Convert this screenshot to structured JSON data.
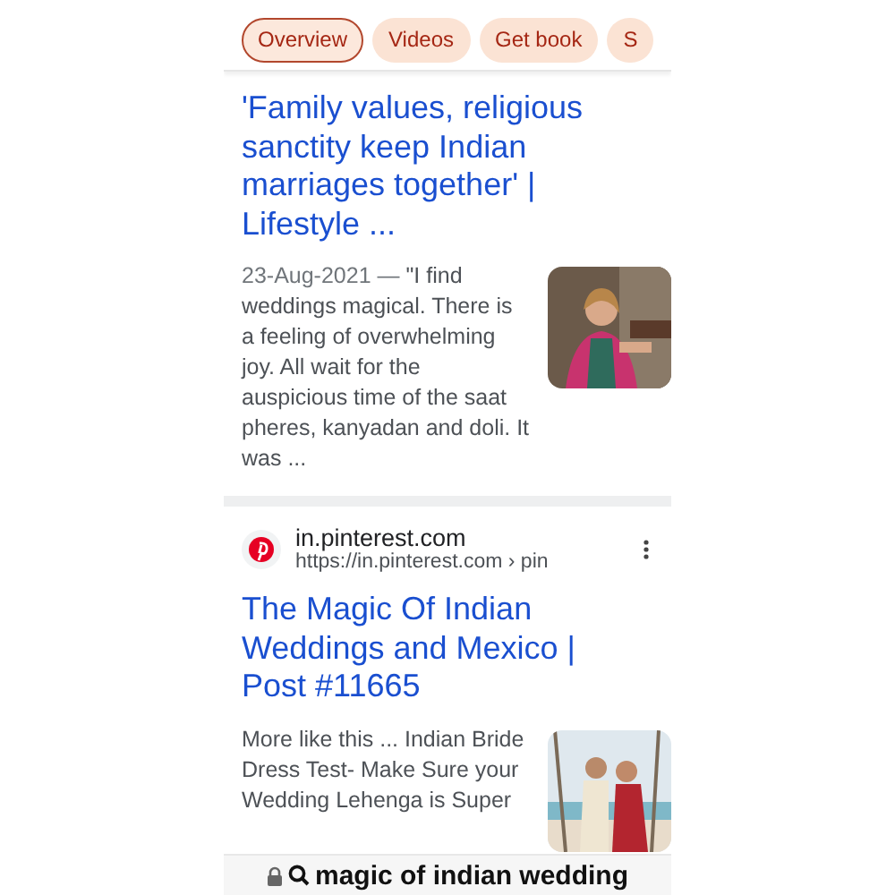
{
  "chips": [
    {
      "label": "Overview",
      "selected": true
    },
    {
      "label": "Videos",
      "selected": false
    },
    {
      "label": "Get book",
      "selected": false
    },
    {
      "label": "S",
      "selected": false
    }
  ],
  "results": [
    {
      "title": "'Family values, religious sanctity keep Indian marriages together' | Lifestyle ...",
      "date": "23-Aug-2021",
      "separator": "—",
      "snippet": "\"I find weddings magical. There is a feeling of overwhelming joy. All wait for the auspicious time of the saat pheres, kanyadan and doli. It was ..."
    },
    {
      "site": "in.pinterest.com",
      "url": "https://in.pinterest.com",
      "path": "› pin",
      "title": "The Magic Of Indian Weddings and Mexico | Post #11665",
      "snippet": "More like this ... Indian Bride Dress Test- Make Sure your Wedding Lehenga is Super"
    }
  ],
  "address_bar": {
    "query": "magic of indian wedding"
  }
}
